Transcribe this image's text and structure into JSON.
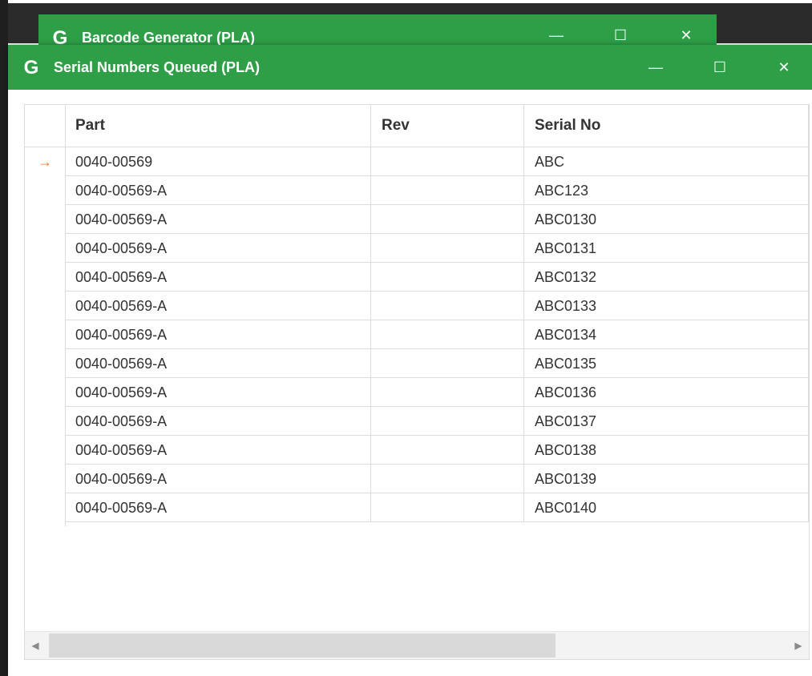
{
  "back_window": {
    "title": "Barcode Generator (PLA)",
    "minimize": "—",
    "maximize": "☐",
    "close": "✕"
  },
  "front_window": {
    "title": "Serial Numbers Queued (PLA)",
    "minimize": "—",
    "maximize": "☐",
    "close": "✕"
  },
  "app_icon_glyph": "G",
  "grid": {
    "columns": [
      "Part",
      "Rev",
      "Serial No"
    ],
    "current_row_indicator": "→",
    "rows": [
      {
        "part": "0040-00569",
        "rev": "",
        "serial": "ABC"
      },
      {
        "part": "0040-00569-A",
        "rev": "",
        "serial": "ABC123"
      },
      {
        "part": "0040-00569-A",
        "rev": "",
        "serial": "ABC0130"
      },
      {
        "part": "0040-00569-A",
        "rev": "",
        "serial": "ABC0131"
      },
      {
        "part": "0040-00569-A",
        "rev": "",
        "serial": "ABC0132"
      },
      {
        "part": "0040-00569-A",
        "rev": "",
        "serial": "ABC0133"
      },
      {
        "part": "0040-00569-A",
        "rev": "",
        "serial": "ABC0134"
      },
      {
        "part": "0040-00569-A",
        "rev": "",
        "serial": "ABC0135"
      },
      {
        "part": "0040-00569-A",
        "rev": "",
        "serial": "ABC0136"
      },
      {
        "part": "0040-00569-A",
        "rev": "",
        "serial": "ABC0137"
      },
      {
        "part": "0040-00569-A",
        "rev": "",
        "serial": "ABC0138"
      },
      {
        "part": "0040-00569-A",
        "rev": "",
        "serial": "ABC0139"
      },
      {
        "part": "0040-00569-A",
        "rev": "",
        "serial": "ABC0140"
      }
    ]
  },
  "scrollbar": {
    "left_arrow": "◀",
    "right_arrow": "▶"
  },
  "colors": {
    "titlebar": "#2e9e47",
    "indicator": "#e87722"
  }
}
